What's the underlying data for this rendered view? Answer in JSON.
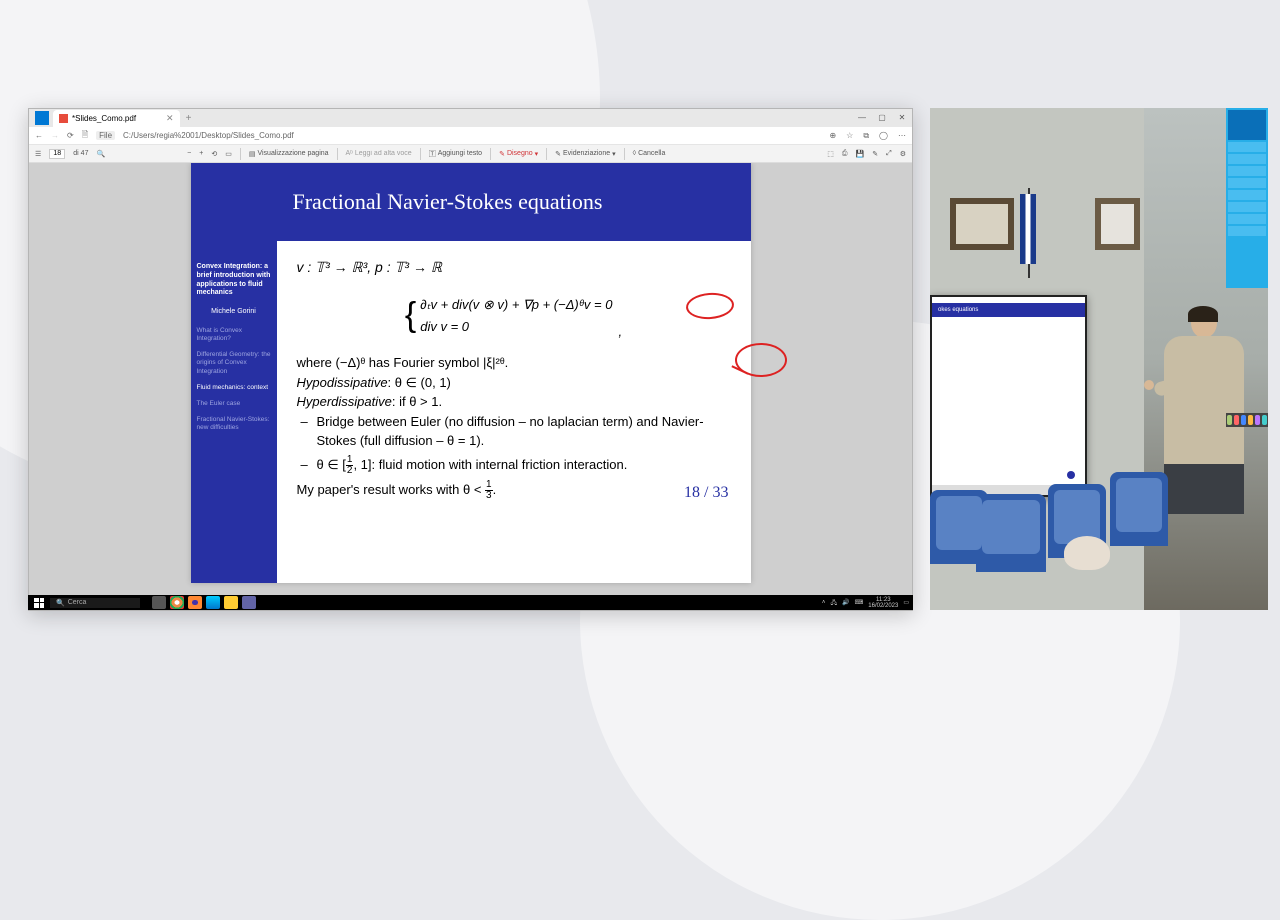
{
  "browser": {
    "tab_title": "*Slides_Como.pdf",
    "url_prefix": "File",
    "url": "C:/Users/regia%2001/Desktop/Slides_Como.pdf",
    "window_controls": {
      "min": "—",
      "max": "▢",
      "close": "✕"
    },
    "new_tab": "+"
  },
  "pdf_toolbar": {
    "current_page": "18",
    "page_count_label": "di 47",
    "view_label": "Visualizzazione pagina",
    "read_aloud": "Leggi ad alta voce",
    "add_text": "Aggiungi testo",
    "draw": "Disegno",
    "highlight": "Evidenziazione",
    "erase": "Cancella"
  },
  "slide": {
    "heading": "Fractional Navier-Stokes equations",
    "sidebar": {
      "title": "Convex Integration: a brief introduction with applications to fluid mechanics",
      "author": "Michele Gorini",
      "sections": [
        "What is Convex Integration?",
        "Differential Geometry: the origins of Convex Integration",
        "Fluid mechanics: context",
        "The Euler case",
        "Fractional Navier-Stokes: new difficulties"
      ],
      "active_index": 2
    },
    "body": {
      "line1": "v : 𝕋³ → ℝ³, p : 𝕋³ → ℝ",
      "eq_top": "∂ₜv + div(v ⊗ v) + ∇p + (−Δ)ᶿv = 0",
      "eq_bottom": "div v = 0",
      "eq_comma": ",",
      "line2a": "where (−Δ)ᶿ has Fourier symbol ",
      "line2b": "|ξ|²ᶿ",
      "line2c": ".",
      "hypo": "Hypodissipative",
      "hypo_tail": ": θ ∈ (0, 1)",
      "hyper": "Hyperdissipative",
      "hyper_tail": ": if θ > 1.",
      "bullet1": "Bridge between Euler (no diffusion – no laplacian term) and Navier-Stokes (full diffusion – θ = 1).",
      "bullet2a": "θ ∈ [",
      "bullet2b": ", 1]: fluid motion with internal friction interaction.",
      "result_a": "My paper's result works with θ < ",
      "result_b": "."
    },
    "page_counter": "18 / 33"
  },
  "taskbar": {
    "search_placeholder": "Cerca",
    "time": "11:23",
    "date": "16/02/2023"
  },
  "camera": {
    "projector_title": "okes equations"
  }
}
